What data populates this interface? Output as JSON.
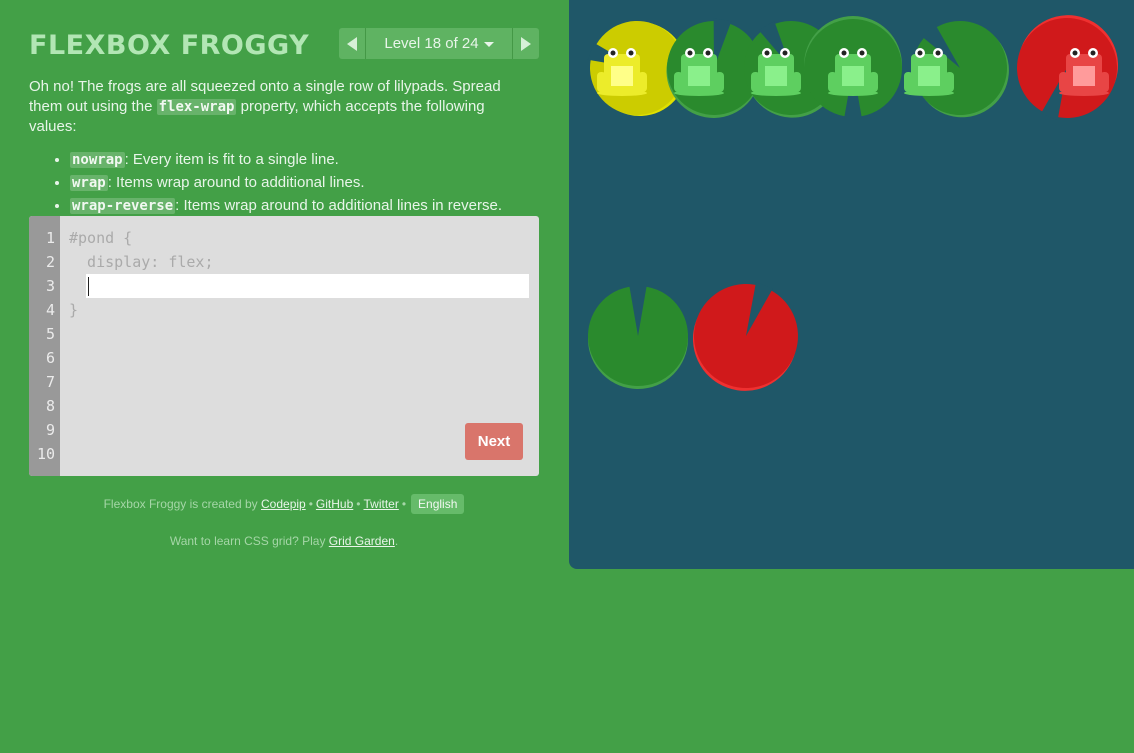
{
  "header": {
    "title": "FLEXBOX FROGGY",
    "level_label": "Level 18 of 24"
  },
  "instructions": {
    "intro_before": "Oh no! The frogs are all squeezed onto a single row of lilypads. Spread them out using the ",
    "property": "flex-wrap",
    "intro_after": " property, which accepts the following values:",
    "values": [
      {
        "code": "nowrap",
        "desc": ": Every item is fit to a single line."
      },
      {
        "code": "wrap",
        "desc": ": Items wrap around to additional lines."
      },
      {
        "code": "wrap-reverse",
        "desc": ": Items wrap around to additional lines in reverse."
      }
    ]
  },
  "editor": {
    "line_numbers": [
      "1",
      "2",
      "3",
      "4",
      "5",
      "6",
      "7",
      "8",
      "9",
      "10"
    ],
    "lines": [
      "#pond {",
      "  display: flex;",
      "",
      "}"
    ],
    "input_value": "",
    "next_label": "Next"
  },
  "footer": {
    "created_by": "Flexbox Froggy is created by",
    "codepip": "Codepip",
    "github": "GitHub",
    "twitter": "Twitter",
    "language": "English",
    "grid_prefix": "Want to learn CSS grid? Play",
    "grid_link": "Grid Garden",
    "grid_suffix": "."
  },
  "pond": {
    "background": "#1f5768",
    "colors": {
      "green_pad": "#2a8a2d",
      "green_pad_rim": "#43a047",
      "yellow_pad": "#cccc00",
      "red_pad": "#d0191b",
      "red_pad_rim": "#ef3030",
      "green_frog": "#5ecf60",
      "yellow_frog": "#ecec2a",
      "red_frog": "#e84545"
    },
    "frogs": [
      "yellow",
      "green",
      "green",
      "green",
      "green",
      "red"
    ],
    "lilypads": [
      "yellow",
      "green",
      "green",
      "green",
      "green",
      "red",
      "green",
      "red"
    ]
  }
}
